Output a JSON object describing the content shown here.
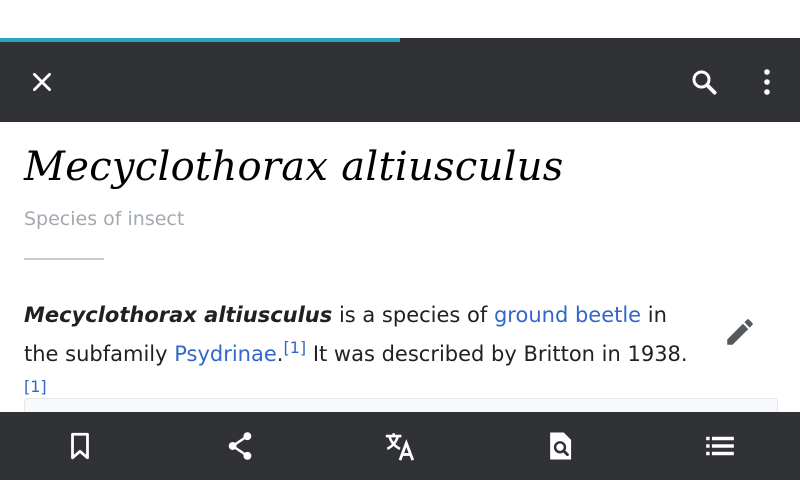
{
  "article": {
    "title": "Mecyclothorax altiusculus",
    "description": "Species of insect",
    "paragraph": {
      "bold": "Mecyclothorax altiusculus",
      "t1": " is a species of ",
      "link1": "ground beetle",
      "t2": " in the subfamily ",
      "link2": "Psydrinae",
      "t3": ".",
      "ref1": "[1]",
      "t4": " It was described by Britton in 1938.",
      "ref2": "[1]"
    }
  },
  "load_progress": 0.5,
  "colors": {
    "toolbar": "#303236",
    "progress": "#2aa3c3",
    "link": "#3366cc",
    "description": "#a2a9b1"
  },
  "icons": {
    "toolbar": [
      "close-icon",
      "search-icon",
      "more-vert-icon"
    ],
    "bottom_bar": [
      "bookmark-icon",
      "share-icon",
      "translate-icon",
      "find-in-page-icon",
      "contents-list-icon"
    ],
    "edit": "pencil-icon"
  }
}
